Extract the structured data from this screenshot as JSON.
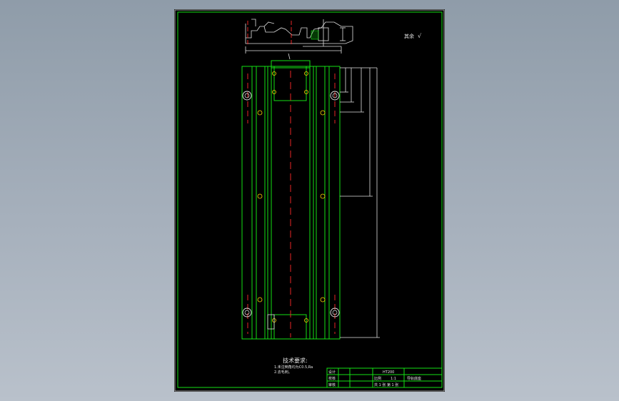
{
  "drawing": {
    "roughness_note": "其余",
    "roughness_symbol": "√",
    "notes": {
      "title": "技术要求:",
      "line1": "1.未注倒角均为C0.5,Ra",
      "line2": "2.去毛刺。"
    },
    "title_block": {
      "material": "HT200",
      "part_name": "导轨底座",
      "scale_label": "比例",
      "scale_value": "1:1",
      "rows": [
        "设计",
        "校核",
        "审核"
      ],
      "sheet_info": "共 1 张   第 1 张"
    }
  },
  "colors": {
    "frame": "#13e013",
    "centerline": "#ff2a2a",
    "dimension": "#e0e0e0",
    "background": "#000000"
  }
}
